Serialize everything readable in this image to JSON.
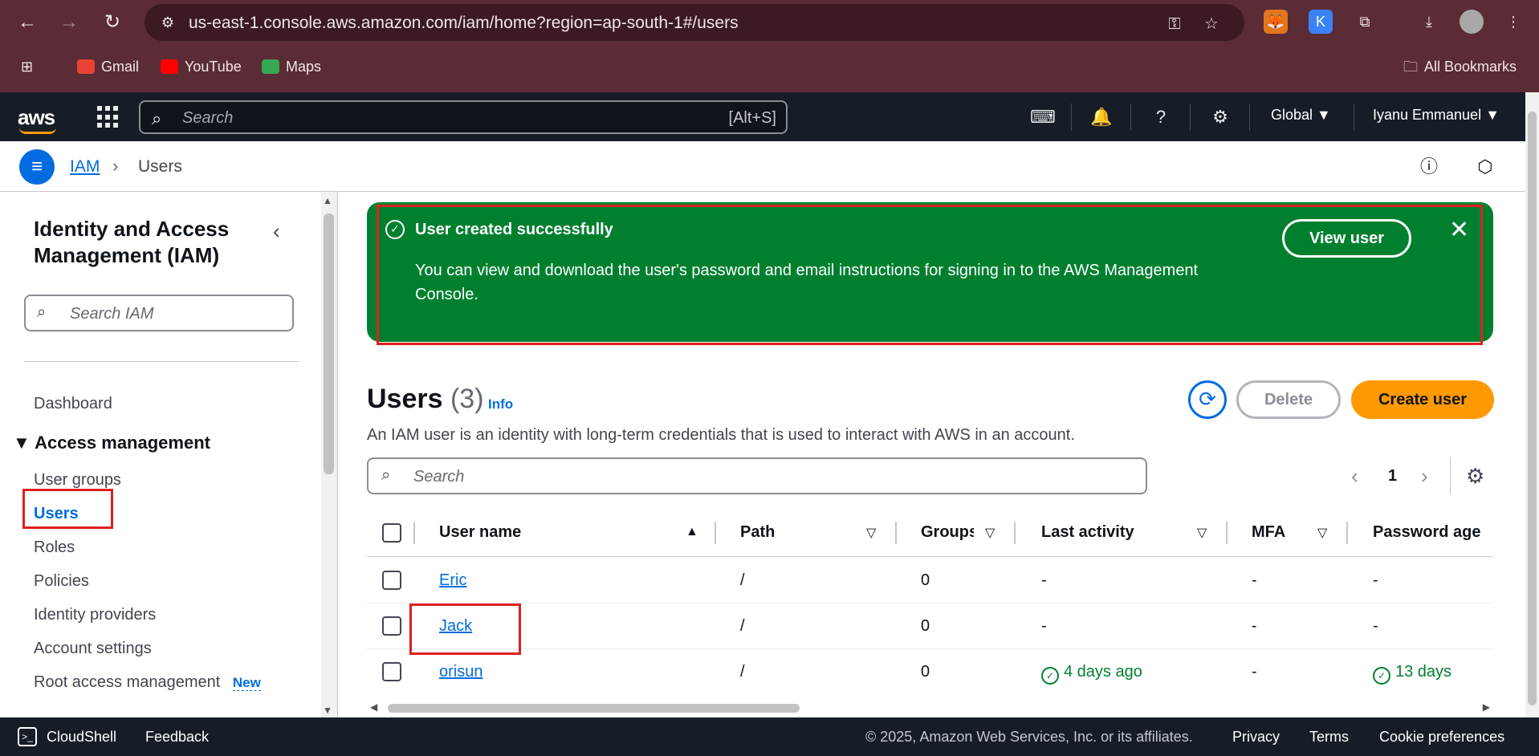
{
  "browser": {
    "url": "us-east-1.console.aws.amazon.com/iam/home?region=ap-south-1#/users",
    "bookmarks": [
      "Gmail",
      "YouTube",
      "Maps"
    ],
    "all_bookmarks": "All Bookmarks"
  },
  "aws_nav": {
    "logo": "aws",
    "search_placeholder": "Search",
    "search_shortcut": "[Alt+S]",
    "region": "Global ▼",
    "account": "Iyanu Emmanuel ▼"
  },
  "breadcrumb": {
    "parent": "IAM",
    "current": "Users"
  },
  "sidebar": {
    "title": "Identity and Access Management (IAM)",
    "search_placeholder": "Search IAM",
    "dashboard": "Dashboard",
    "section": "Access management",
    "items": [
      "User groups",
      "Users",
      "Roles",
      "Policies",
      "Identity providers",
      "Account settings",
      "Root access management"
    ],
    "new_badge": "New"
  },
  "flash": {
    "title": "User created successfully",
    "body": "You can view and download the user's password and email instructions for signing in to the AWS Management Console.",
    "button": "View user"
  },
  "users": {
    "title": "Users",
    "count": "(3)",
    "info": "Info",
    "description": "An IAM user is an identity with long-term credentials that is used to interact with AWS in an account.",
    "delete": "Delete",
    "create": "Create user",
    "search_placeholder": "Search",
    "page": "1"
  },
  "table": {
    "columns": [
      "User name",
      "Path",
      "Groups",
      "Last activity",
      "MFA",
      "Password age"
    ],
    "rows": [
      {
        "name": "Eric",
        "path": "/",
        "groups": "0",
        "last_activity": "-",
        "mfa": "-",
        "password_age": "-"
      },
      {
        "name": "Jack",
        "path": "/",
        "groups": "0",
        "last_activity": "-",
        "mfa": "-",
        "password_age": "-"
      },
      {
        "name": "orisun",
        "path": "/",
        "groups": "0",
        "last_activity": "4 days ago",
        "mfa": "-",
        "password_age": "13 days"
      }
    ]
  },
  "footer": {
    "cloudshell": "CloudShell",
    "feedback": "Feedback",
    "copyright": "© 2025, Amazon Web Services, Inc. or its affiliates.",
    "privacy": "Privacy",
    "terms": "Terms",
    "cookies": "Cookie preferences"
  },
  "colors": {
    "aws_nav": "#161d26",
    "link_blue": "#006ce0",
    "success_green": "#00802f",
    "primary_orange": "#ff9900",
    "highlight_red": "#e0201f",
    "browser_frame": "#5b2c35"
  }
}
